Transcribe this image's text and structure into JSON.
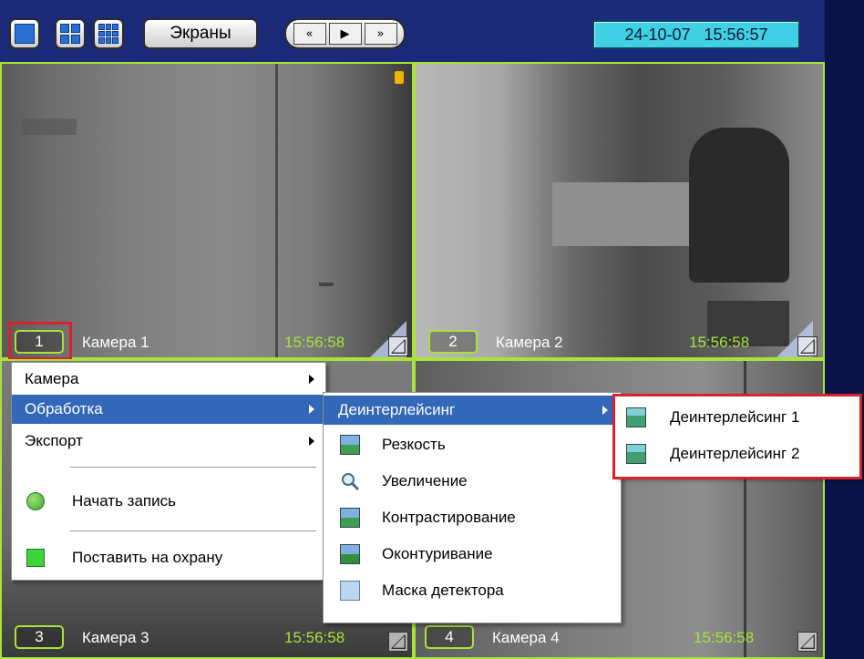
{
  "toolbar": {
    "screens_label": "Экраны",
    "nav_prev": "«",
    "nav_play": "▶",
    "nav_next": "»",
    "datetime": "24-10-07   15:56:57"
  },
  "cameras": [
    {
      "number": "1",
      "name": "Камера 1",
      "time": "15:56:58"
    },
    {
      "number": "2",
      "name": "Камера 2",
      "time": "15:56:58"
    },
    {
      "number": "3",
      "name": "Камера 3",
      "time": "15:56:58"
    },
    {
      "number": "4",
      "name": "Камера 4",
      "time": "15:56:58"
    }
  ],
  "context_menu": {
    "items": [
      {
        "label": "Камера"
      },
      {
        "label": "Обработка"
      },
      {
        "label": "Экспорт"
      },
      {
        "label": "Начать запись"
      },
      {
        "label": "Поставить на охрану"
      }
    ]
  },
  "processing_submenu": {
    "items": [
      {
        "label": "Деинтерлейсинг"
      },
      {
        "label": "Резкость"
      },
      {
        "label": "Увеличение"
      },
      {
        "label": "Контрастирование"
      },
      {
        "label": "Оконтуривание"
      },
      {
        "label": "Маска детектора"
      }
    ]
  },
  "deinterlacing_submenu": {
    "items": [
      {
        "label": "Деинтерлейсинг 1"
      },
      {
        "label": "Деинтерлейсинг 2"
      }
    ]
  },
  "colors": {
    "accent_green": "#a7e33a",
    "menu_selection": "#3367b8",
    "highlight_red": "#d7242c",
    "datetime_bg": "#3fd0e6"
  }
}
